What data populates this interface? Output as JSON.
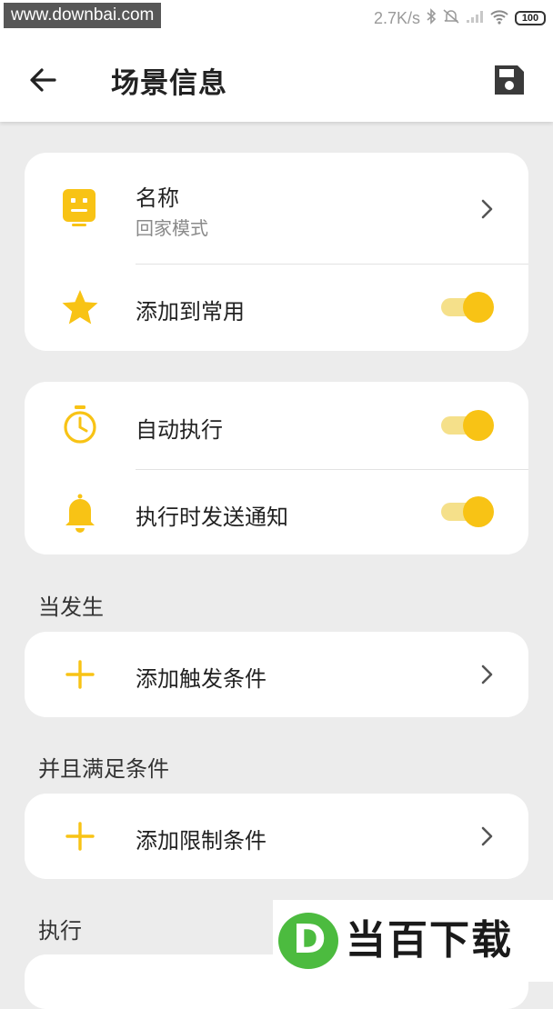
{
  "status_bar": {
    "watermark": "www.downbai.com",
    "net_speed": "2.7K/s",
    "battery": "100"
  },
  "header": {
    "title": "场景信息"
  },
  "card1": {
    "name_label": "名称",
    "name_value": "回家模式",
    "favorite_label": "添加到常用",
    "favorite_on": true
  },
  "card2": {
    "auto_run_label": "自动执行",
    "auto_run_on": true,
    "notify_label": "执行时发送通知",
    "notify_on": true
  },
  "sections": {
    "trigger_title": "当发生",
    "trigger_add": "添加触发条件",
    "condition_title": "并且满足条件",
    "condition_add": "添加限制条件",
    "action_title": "执行"
  },
  "brand_watermark": "当百下载",
  "colors": {
    "accent": "#F8C315",
    "toggle_track": "#F5E08A",
    "background": "#ECECEC"
  }
}
